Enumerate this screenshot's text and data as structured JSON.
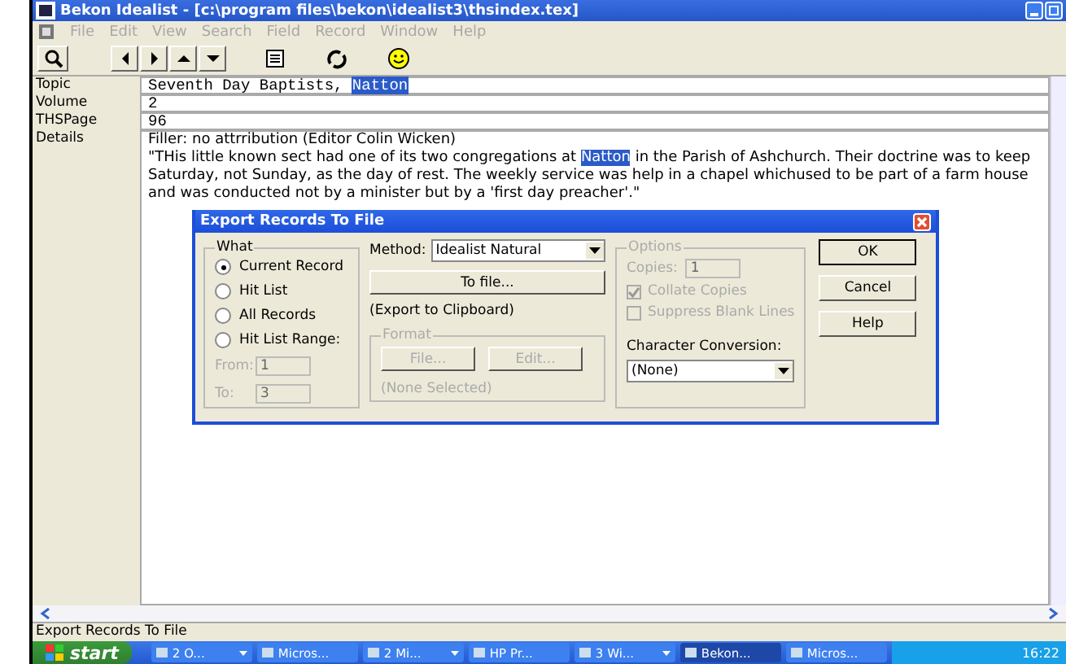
{
  "window": {
    "title": "Bekon Idealist - [c:\\program files\\bekon\\idealist3\\thsindex.tex]"
  },
  "menu": [
    {
      "label": "File",
      "disabled": true
    },
    {
      "label": "Edit",
      "disabled": true
    },
    {
      "label": "View",
      "disabled": true
    },
    {
      "label": "Search",
      "disabled": true
    },
    {
      "label": "Field",
      "disabled": true
    },
    {
      "label": "Record",
      "disabled": true
    },
    {
      "label": "Window",
      "disabled": true
    },
    {
      "label": "Help",
      "disabled": true
    }
  ],
  "fields": [
    {
      "label": "Topic",
      "mono": true,
      "value": "Seventh Day Baptists, **Natton**"
    },
    {
      "label": "Volume",
      "mono": true,
      "value": "2"
    },
    {
      "label": "THSPage",
      "mono": true,
      "value": "96"
    },
    {
      "label": "Details",
      "mono": false,
      "lines": [
        "Filler: no attrribution (Editor Colin Wicken)",
        "\"THis little known sect had one of its two congregations at **Natton** in the Parish of Ashchurch.  Their doctrine was to keep Saturday, not Sunday, as the day of rest.  The weekly service was help in a chapel whichused to be part of a farm house and was conducted not by a minister but by a 'first day preacher'.\""
      ]
    }
  ],
  "dialog": {
    "title": "Export Records To File",
    "what": {
      "legend": "What",
      "options": [
        {
          "label": "Current Record",
          "selected": true
        },
        {
          "label": "Hit List",
          "selected": false
        },
        {
          "label": "All Records",
          "selected": false
        },
        {
          "label": "Hit List Range:",
          "selected": false
        }
      ],
      "from_label": "From:",
      "from_value": "1",
      "to_label": "To:",
      "to_value": "3"
    },
    "method_label": "Method:",
    "method_value": "Idealist Natural",
    "to_file_button": "To file...",
    "clipboard_note": "(Export to Clipboard)",
    "format": {
      "legend": "Format",
      "file_button": "File...",
      "edit_button": "Edit...",
      "note": "(None Selected)"
    },
    "options": {
      "legend": "Options",
      "copies_label": "Copies:",
      "copies_value": "1",
      "checks": [
        {
          "label": "Collate Copies",
          "checked": true
        },
        {
          "label": "Suppress Blank Lines",
          "checked": false
        }
      ]
    },
    "conversion_label": "Character Conversion:",
    "conversion_value": "(None)",
    "buttons": [
      "OK",
      "Cancel",
      "Help"
    ]
  },
  "status_bar": "Export Records To File",
  "taskbar": {
    "start": "start",
    "items": [
      {
        "label": "2 O...",
        "group": true,
        "selected": false
      },
      {
        "label": "Micros...",
        "group": false,
        "selected": false
      },
      {
        "label": "2 Mi...",
        "group": true,
        "selected": false
      },
      {
        "label": "HP Pr...",
        "group": false,
        "selected": false
      },
      {
        "label": "3 Wi...",
        "group": true,
        "selected": false
      },
      {
        "label": "Bekon...",
        "group": false,
        "selected": true
      },
      {
        "label": "Micros...",
        "group": false,
        "selected": false
      }
    ],
    "clock": "16:22"
  }
}
